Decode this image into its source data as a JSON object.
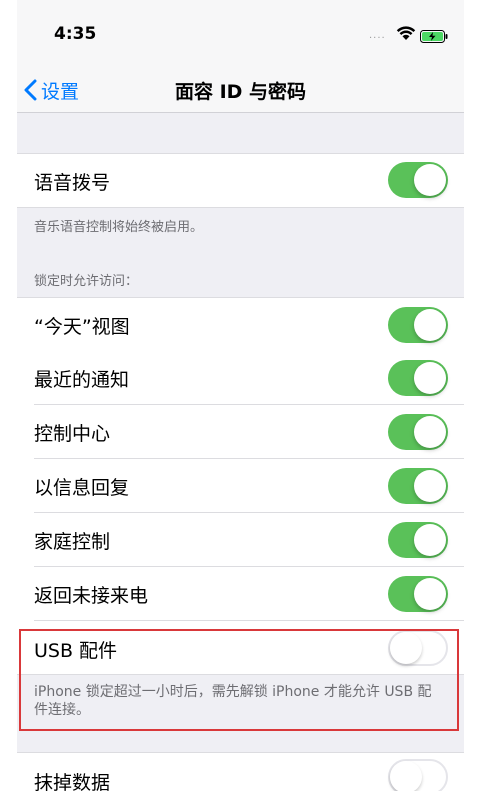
{
  "status_bar": {
    "time": "4:35",
    "signal": "....",
    "wifi_icon": "wifi-icon",
    "battery_icon": "battery-charging-icon"
  },
  "nav": {
    "back_label": "设置",
    "title": "面容 ID 与密码",
    "accent": "#007aff"
  },
  "voice_dial": {
    "label": "语音拨号",
    "on": true,
    "note": "音乐语音控制将始终被启用。"
  },
  "lock_access_header": "锁定时允许访问：",
  "lock_items": [
    {
      "label": "“今天”视图",
      "on": true
    },
    {
      "label": "最近的通知",
      "on": true
    },
    {
      "label": "控制中心",
      "on": true
    },
    {
      "label": "以信息回复",
      "on": true
    },
    {
      "label": "家庭控制",
      "on": true
    },
    {
      "label": "返回未接来电",
      "on": true
    },
    {
      "label": "USB 配件",
      "on": false
    }
  ],
  "usb_note": "iPhone 锁定超过一小时后，需先解锁 iPhone 才能允许 USB 配件连接。",
  "erase": {
    "label": "抹掉数据",
    "on": false
  },
  "colors": {
    "toggle_on": "#5ac159",
    "highlight": "#d9383a"
  }
}
